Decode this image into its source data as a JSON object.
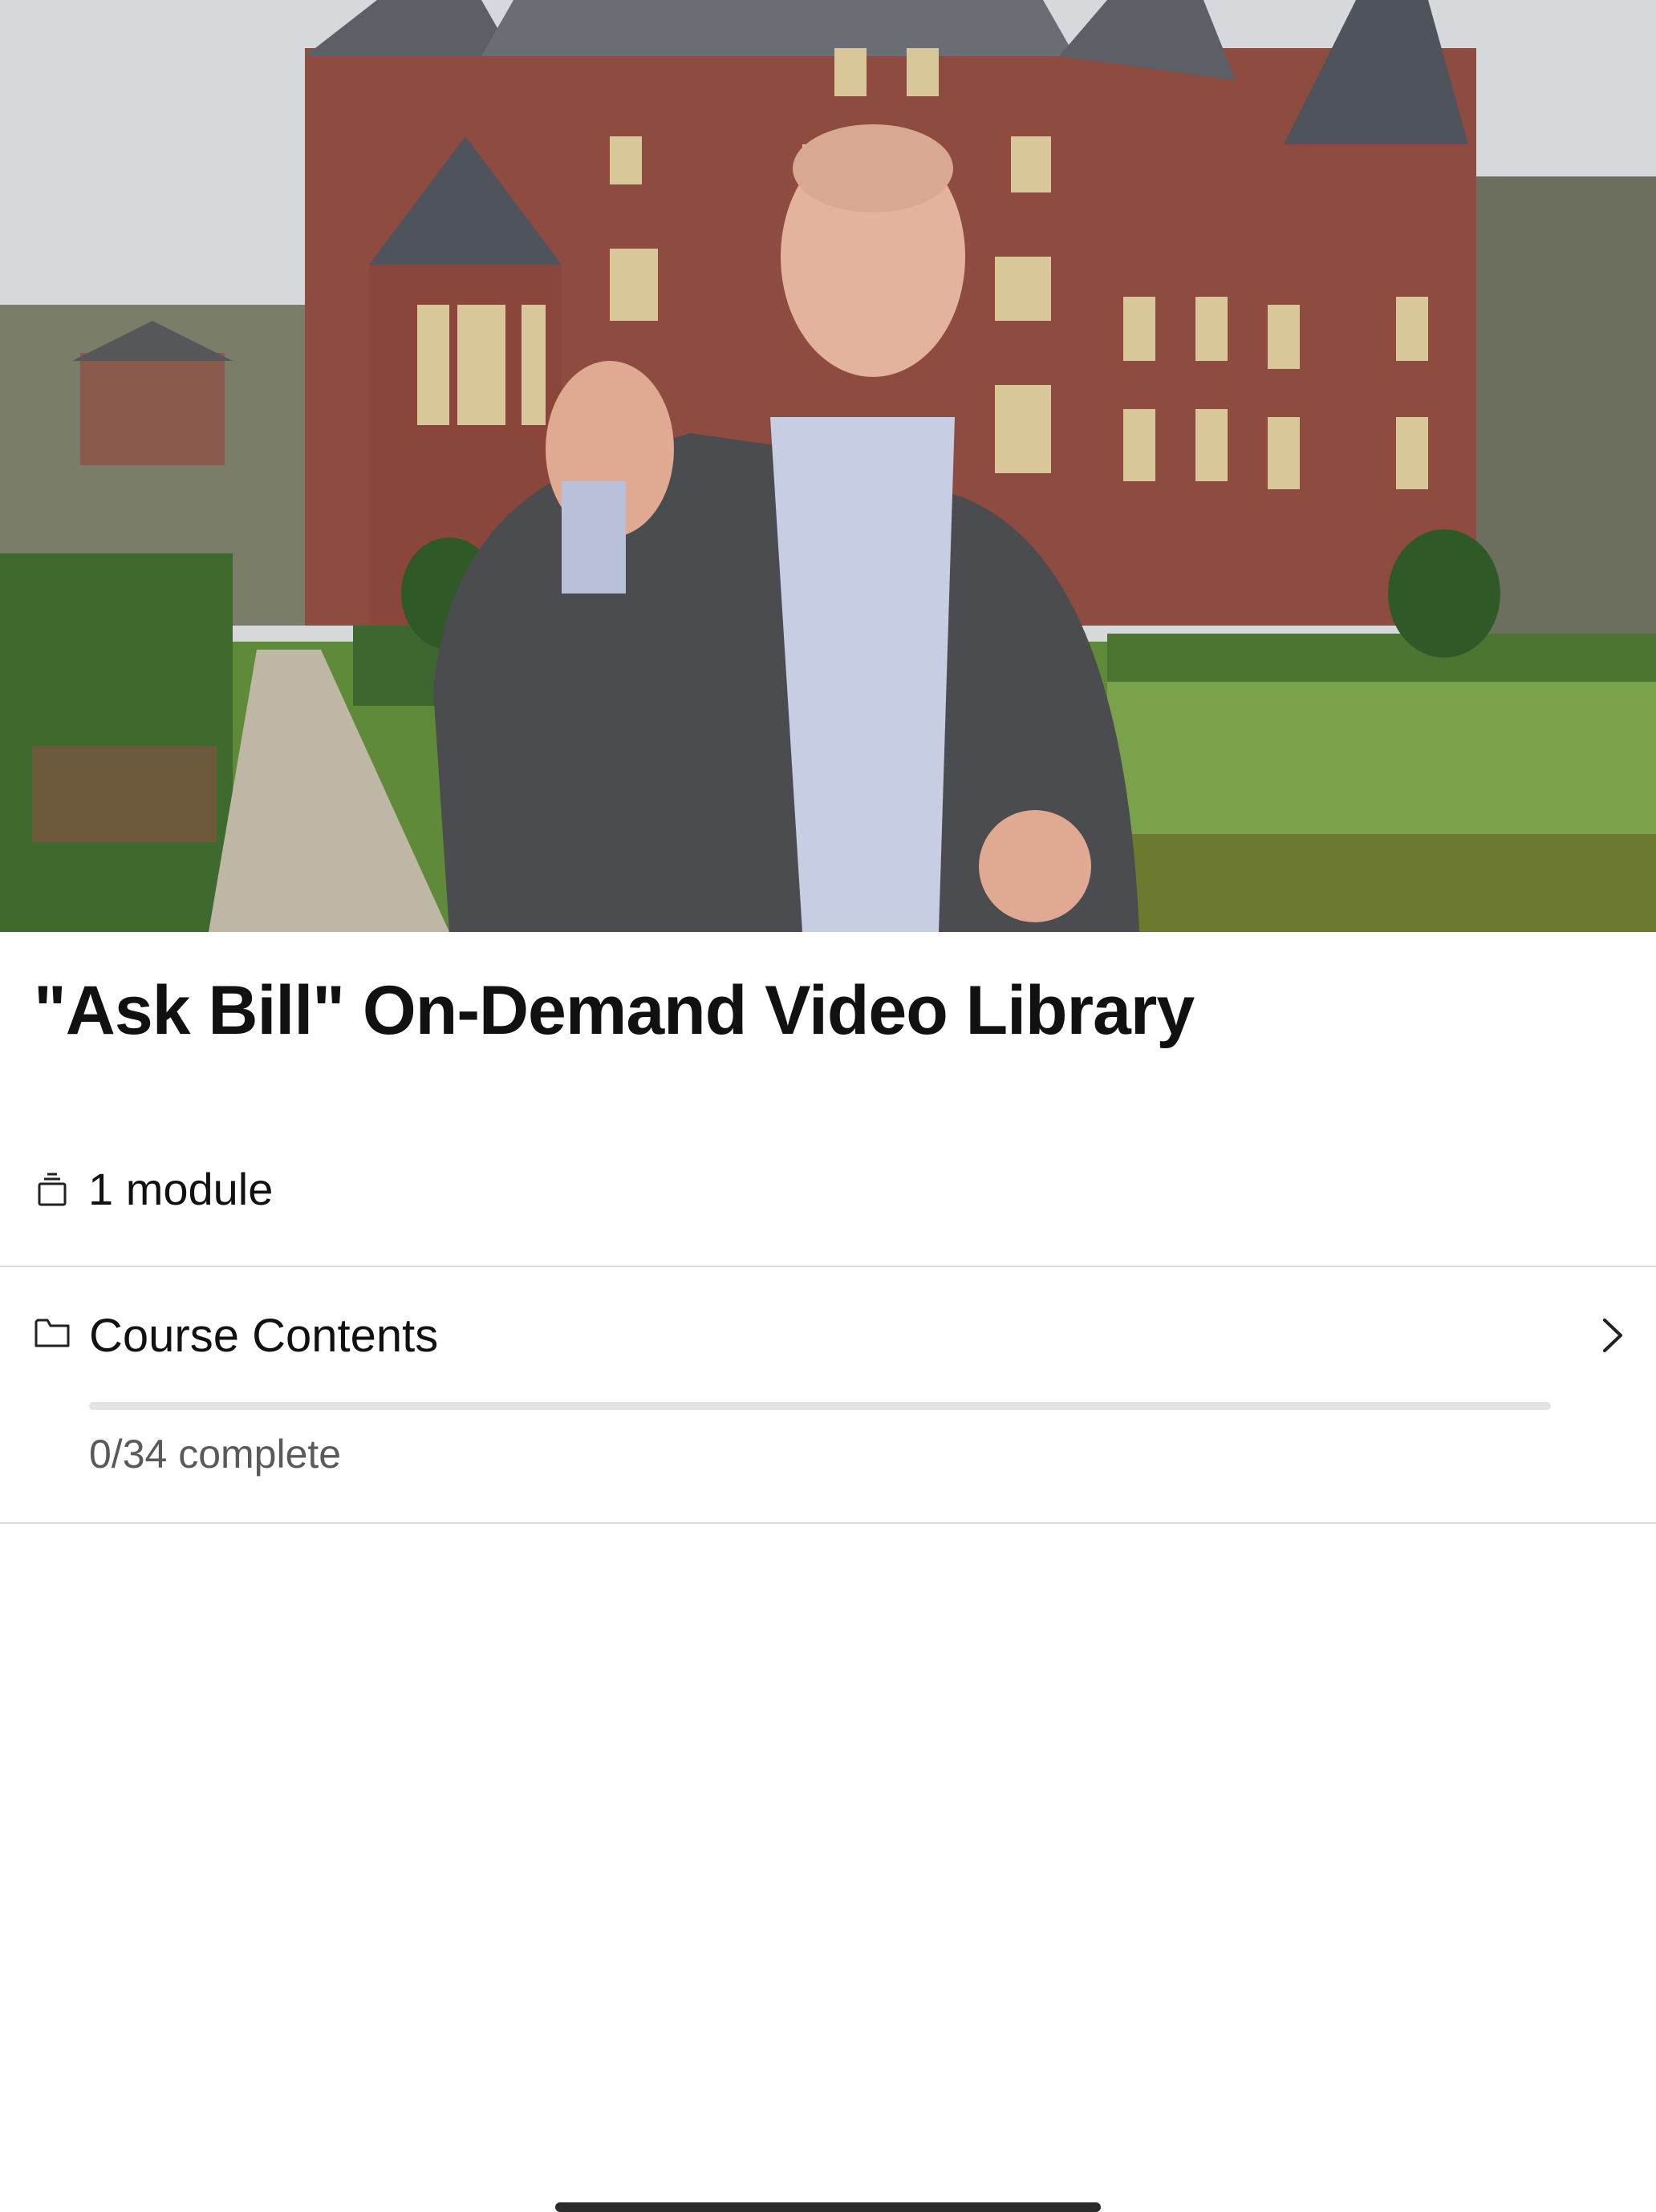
{
  "hero": {
    "image_description": "course thumbnail"
  },
  "course": {
    "title": "\"Ask Bill\" On-Demand Video Library",
    "modules_text": "1 module",
    "modules_icon": "layers-icon"
  },
  "contents": {
    "label": "Course Contents",
    "folder_icon": "folder-icon",
    "chevron_icon": "chevron-right-icon",
    "progress_fraction": 0,
    "status_text": "0/34 complete"
  },
  "colors": {
    "text": "#111111",
    "muted": "#5a5a5a",
    "divider": "#dcdcdc",
    "track": "#e3e3e3"
  }
}
